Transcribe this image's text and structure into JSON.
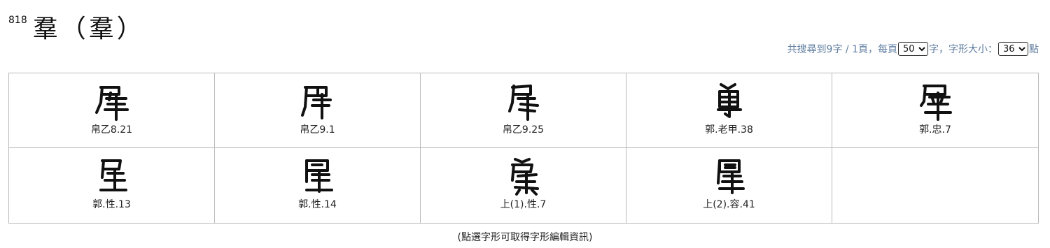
{
  "header": {
    "number": "818",
    "glyph_title": "羣（羣）"
  },
  "status": {
    "prefix": "共搜尋到9字 / 1頁，每頁",
    "per_page_value": "50",
    "per_page_options": [
      "50"
    ],
    "middle": "字，字形大小：",
    "size_value": "36",
    "size_options": [
      "36"
    ],
    "suffix": "點"
  },
  "cells": [
    {
      "label": "帛乙8.21",
      "icon": "qun-glyph-variant-1"
    },
    {
      "label": "帛乙9.1",
      "icon": "qun-glyph-variant-2"
    },
    {
      "label": "帛乙9.25",
      "icon": "qun-glyph-variant-3"
    },
    {
      "label": "郭.老甲.38",
      "icon": "qun-glyph-variant-4"
    },
    {
      "label": "郭.忠.7",
      "icon": "qun-glyph-variant-5"
    },
    {
      "label": "郭.性.13",
      "icon": "qun-glyph-variant-6"
    },
    {
      "label": "郭.性.14",
      "icon": "qun-glyph-variant-7"
    },
    {
      "label": "上(1).性.7",
      "icon": "qun-glyph-variant-8"
    },
    {
      "label": "上(2).容.41",
      "icon": "qun-glyph-variant-9"
    }
  ],
  "footer": {
    "note": "(點選字形可取得字形編輯資訊)"
  }
}
